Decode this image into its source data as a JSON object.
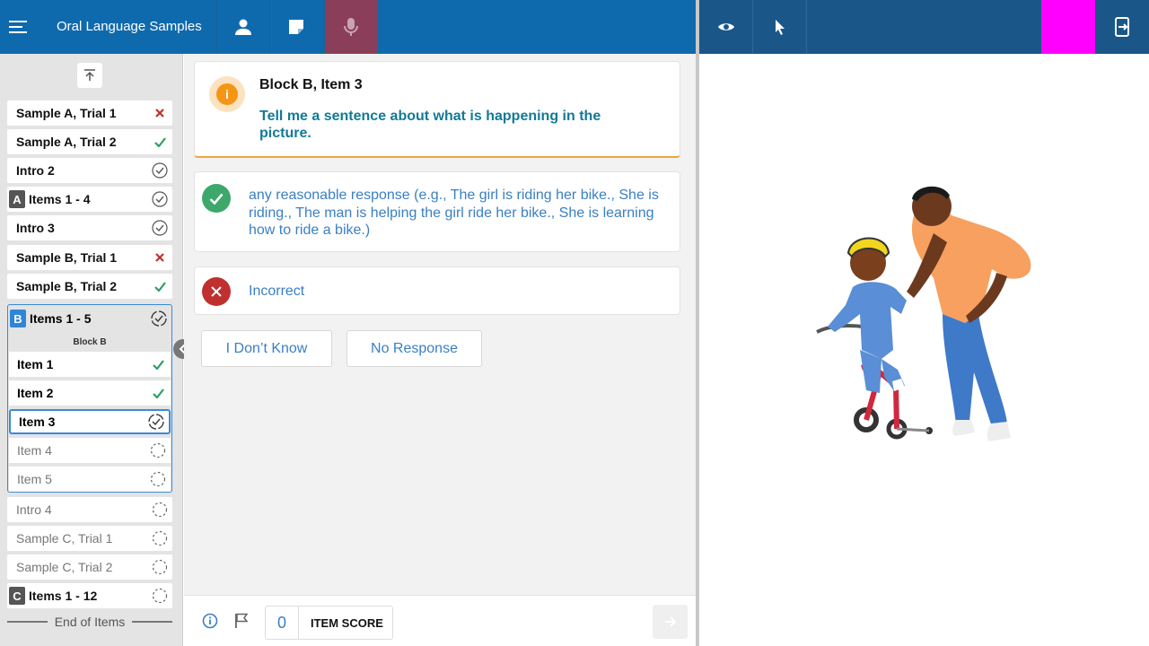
{
  "header": {
    "title": "Oral Language Samples",
    "icons": [
      "menu-icon",
      "user-icon",
      "note-icon",
      "microphone-icon"
    ],
    "right_icons": [
      "eye-icon",
      "pointer-icon",
      "exit-icon"
    ],
    "colors": {
      "bar": "#0f6aad",
      "active_tab": "#8b3e5a",
      "right_bar": "#1a5788",
      "marker": "#ff00ff"
    }
  },
  "sidebar": {
    "items_top": [
      {
        "label": "Sample A, Trial 1",
        "status": "incorrect"
      },
      {
        "label": "Sample A, Trial 2",
        "status": "correct"
      },
      {
        "label": "Intro 2",
        "status": "complete"
      },
      {
        "badge": "A",
        "label": "Items 1 - 4",
        "status": "complete"
      },
      {
        "label": "Intro 3",
        "status": "complete"
      },
      {
        "label": "Sample B, Trial 1",
        "status": "incorrect"
      },
      {
        "label": "Sample B, Trial 2",
        "status": "correct"
      }
    ],
    "block": {
      "badge": "B",
      "label": "Items 1 - 5",
      "subtitle": "Block B",
      "items": [
        {
          "label": "Item 1",
          "status": "correct"
        },
        {
          "label": "Item 2",
          "status": "correct"
        },
        {
          "label": "Item 3",
          "status": "in-progress"
        },
        {
          "label": "Item 4",
          "status": "pending"
        },
        {
          "label": "Item 5",
          "status": "pending"
        }
      ]
    },
    "items_bottom": [
      {
        "label": "Intro 4",
        "status": "pending"
      },
      {
        "label": "Sample C, Trial 1",
        "status": "pending"
      },
      {
        "label": "Sample C, Trial 2",
        "status": "pending"
      },
      {
        "badge": "C",
        "label": "Items 1 - 12",
        "status": "pending"
      }
    ],
    "end_label": "End of Items"
  },
  "question": {
    "title": "Block B, Item 3",
    "prompt": "Tell me a sentence about what is happening in the picture."
  },
  "responses": {
    "correct": "any reasonable response (e.g., The girl is riding her bike., She is riding., The man is helping the girl ride her bike., She is learning how to ride a bike.)",
    "incorrect": "Incorrect"
  },
  "options": {
    "dont_know": "I Don’t Know",
    "no_response": "No Response"
  },
  "footer": {
    "score": "0",
    "score_label": "ITEM SCORE"
  }
}
